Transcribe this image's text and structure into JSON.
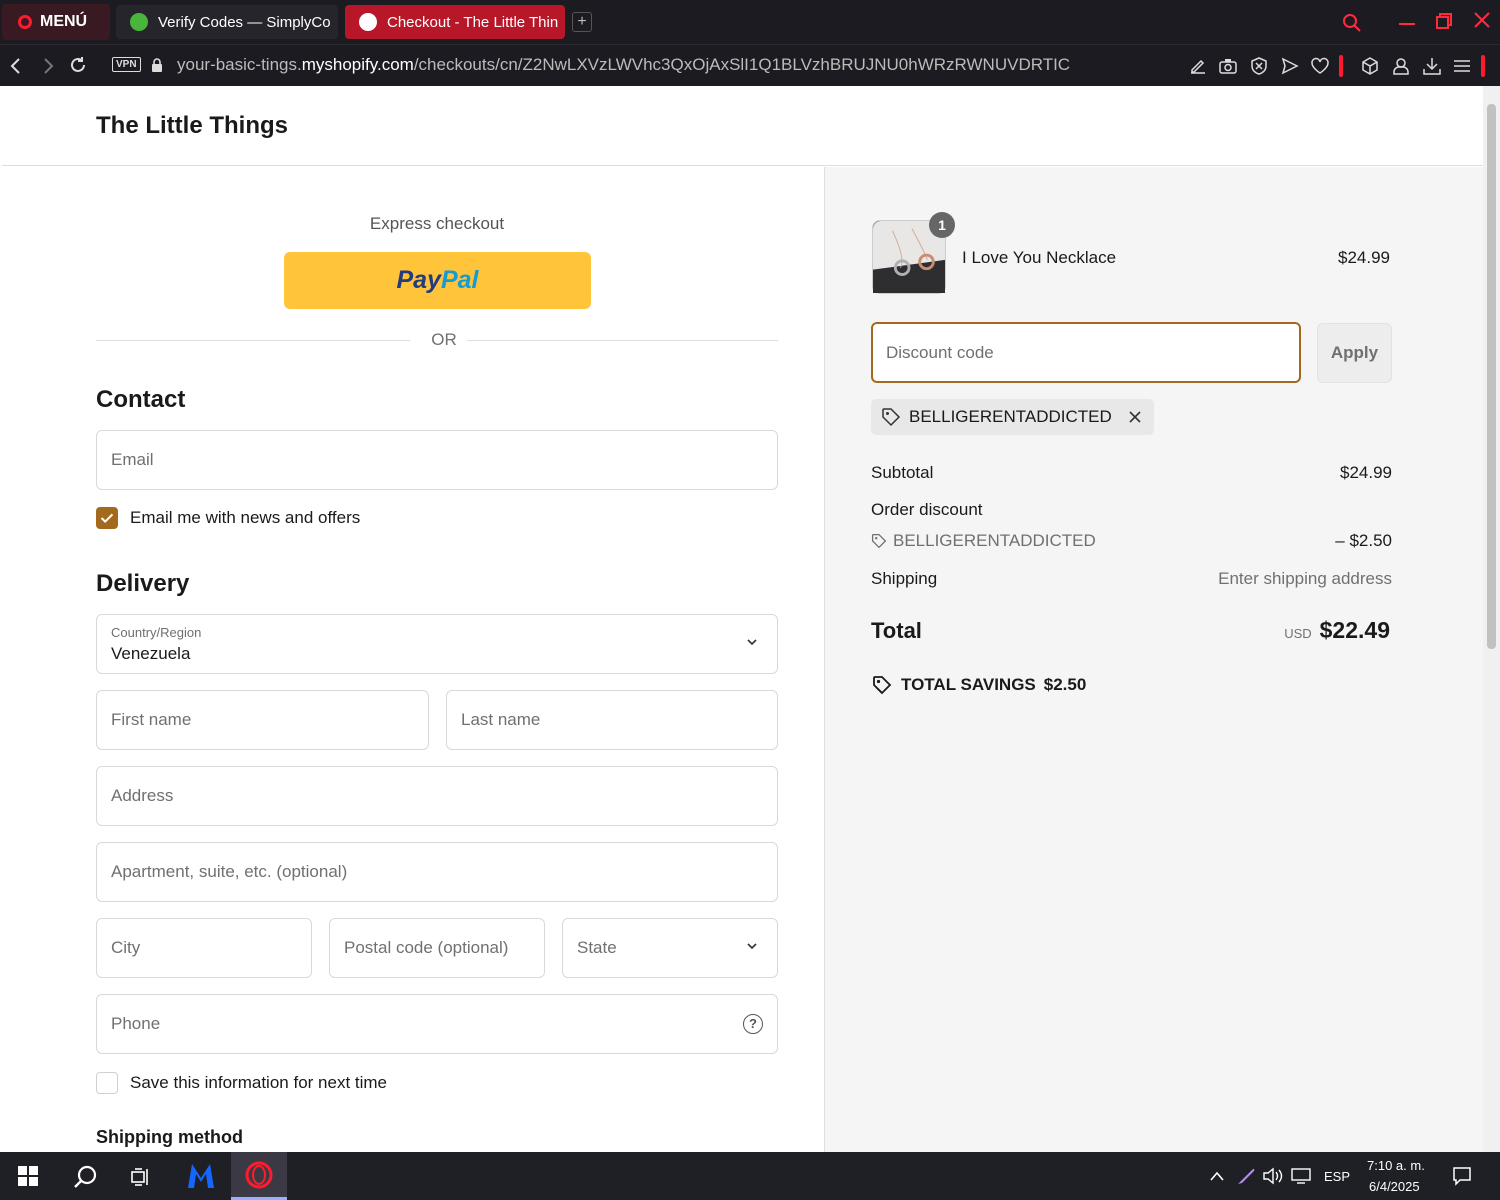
{
  "browser": {
    "menu_label": "MENÚ",
    "tabs": [
      {
        "title": "Verify Codes — SimplyCo"
      },
      {
        "title": "Checkout - The Little Thin"
      }
    ],
    "new_tab": "+",
    "vpn_badge": "VPN",
    "url_prefix": "your-basic-tings.",
    "url_domain": "myshopify.com",
    "url_path": "/checkouts/cn/Z2NwLXVzLWVhc3QxOjAxSlI1Q1BLVzhBRUJNU0hWRzRWNUVDRTIC"
  },
  "header": {
    "store_name": "The Little Things"
  },
  "express": {
    "label": "Express checkout",
    "paypal_a": "Pay",
    "paypal_b": "Pal",
    "or": "OR"
  },
  "contact": {
    "title": "Contact",
    "email_placeholder": "Email",
    "newsletter_label": "Email me with news and offers",
    "newsletter_checked": true
  },
  "delivery": {
    "title": "Delivery",
    "country_label": "Country/Region",
    "country_value": "Venezuela",
    "first_name_placeholder": "First name",
    "last_name_placeholder": "Last name",
    "address_placeholder": "Address",
    "apartment_placeholder": "Apartment, suite, etc. (optional)",
    "city_placeholder": "City",
    "postal_placeholder": "Postal code (optional)",
    "state_placeholder": "State",
    "phone_placeholder": "Phone",
    "help_icon": "?",
    "save_info_label": "Save this information for next time",
    "shipping_method_title": "Shipping method"
  },
  "summary": {
    "item": {
      "name": "I Love You Necklace",
      "price": "$24.99",
      "quantity": "1"
    },
    "discount_placeholder": "Discount code",
    "apply_label": "Apply",
    "applied_code": "BELLIGERENTADDICTED",
    "subtotal_label": "Subtotal",
    "subtotal_value": "$24.99",
    "order_discount_label": "Order discount",
    "order_discount_code": "BELLIGERENTADDICTED",
    "order_discount_value": "– $2.50",
    "shipping_label": "Shipping",
    "shipping_value": "Enter shipping address",
    "total_label": "Total",
    "total_currency": "USD",
    "total_value": "$22.49",
    "savings_label": "TOTAL SAVINGS",
    "savings_value": "$2.50"
  },
  "taskbar": {
    "language": "ESP",
    "time": "7:10 a. m.",
    "date": "6/4/2025"
  },
  "colors": {
    "accent": "#a36a1e",
    "paypal_yellow": "#ffc439",
    "opera_red": "#ff1b2d"
  }
}
